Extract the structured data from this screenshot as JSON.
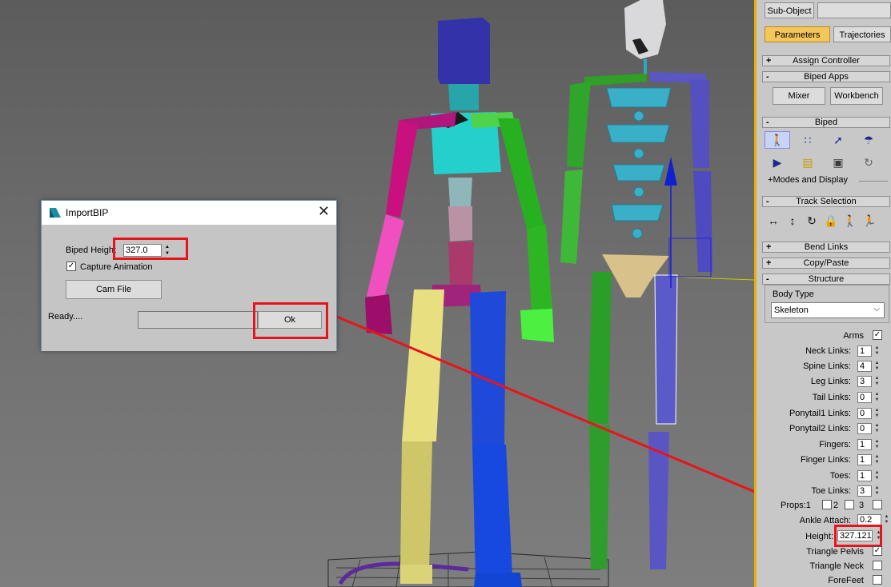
{
  "dialog": {
    "title": "ImportBIP",
    "biped_height_label": "Biped Height",
    "biped_height_value": "327.0",
    "capture_animation_label": "Capture Animation",
    "cam_file_label": "Cam File",
    "status": "Ready....",
    "ok_label": "Ok"
  },
  "panel": {
    "sub_object_label": "Sub-Object",
    "tabs": [
      {
        "label": "Parameters"
      },
      {
        "label": "Trajectories"
      }
    ],
    "rollouts": {
      "assign_controller": "Assign Controller",
      "biped_apps": "Biped Apps",
      "biped": "Biped",
      "modes_display": "Modes and Display",
      "track_selection": "Track Selection",
      "bend_links": "Bend Links",
      "copy_paste": "Copy/Paste",
      "structure": "Structure"
    },
    "mixer_label": "Mixer",
    "workbench_label": "Workbench",
    "body_type_label": "Body Type",
    "body_type_value": "Skeleton",
    "params": [
      {
        "label": "Arms",
        "kind": "check",
        "checked": true
      },
      {
        "label": "Neck Links:",
        "kind": "spin",
        "value": "1"
      },
      {
        "label": "Spine Links:",
        "kind": "spin",
        "value": "4"
      },
      {
        "label": "Leg Links:",
        "kind": "spin",
        "value": "3"
      },
      {
        "label": "Tail Links:",
        "kind": "spin",
        "value": "0"
      },
      {
        "label": "Ponytail1 Links:",
        "kind": "spin",
        "value": "0"
      },
      {
        "label": "Ponytail2 Links:",
        "kind": "spin",
        "value": "0"
      },
      {
        "label": "Fingers:",
        "kind": "spin",
        "value": "1"
      },
      {
        "label": "Finger Links:",
        "kind": "spin",
        "value": "1"
      },
      {
        "label": "Toes:",
        "kind": "spin",
        "value": "1"
      },
      {
        "label": "Toe Links:",
        "kind": "spin",
        "value": "3"
      }
    ],
    "props_label": "Props:",
    "props_options": [
      "1",
      "2",
      "3"
    ],
    "ankle_attach_label": "Ankle Attach:",
    "ankle_attach_value": "0.2",
    "height_label": "Height:",
    "height_value": "327.121",
    "triangle_pelvis_label": "Triangle Pelvis",
    "triangle_neck_label": "Triangle Neck",
    "forefeet_label": "ForeFeet"
  },
  "colors": {
    "highlight_red": "#e8141c",
    "panel_accent": "#e8b000",
    "active_tab": "#f5c65a"
  },
  "icons": [
    "biped-figure-icon",
    "footsteps-icon",
    "run-icon",
    "mushroom-icon",
    "play-icon",
    "open-folder-icon",
    "save-icon",
    "refresh-icon",
    "key-icon",
    "move-horizontal-icon",
    "move-vertical-icon",
    "rotate-icon",
    "lock-icon",
    "symmetrical-icon",
    "opposite-icon"
  ]
}
